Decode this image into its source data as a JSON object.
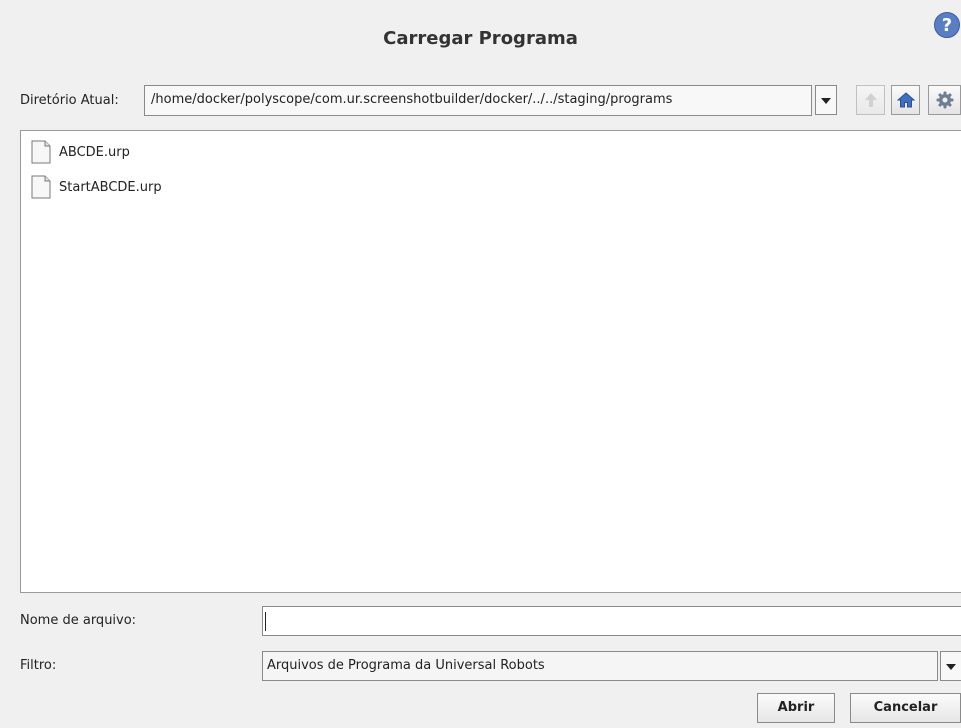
{
  "dialog": {
    "title": "Carregar Programa",
    "help_symbol": "?"
  },
  "directory": {
    "label": "Diretório Atual:",
    "path": "/home/docker/polyscope/com.ur.screenshotbuilder/docker/../../staging/programs",
    "buttons": [
      "arrow-up-icon",
      "home-icon",
      "gear-icon"
    ]
  },
  "files": [
    {
      "name": "ABCDE.urp",
      "icon": "file-icon"
    },
    {
      "name": "StartABCDE.urp",
      "icon": "file-icon"
    }
  ],
  "filename": {
    "label": "Nome de arquivo:",
    "value": ""
  },
  "filter": {
    "label": "Filtro:",
    "value": "Arquivos de Programa da Universal Robots"
  },
  "actions": {
    "open_label": "Abrir",
    "cancel_label": "Cancelar"
  }
}
